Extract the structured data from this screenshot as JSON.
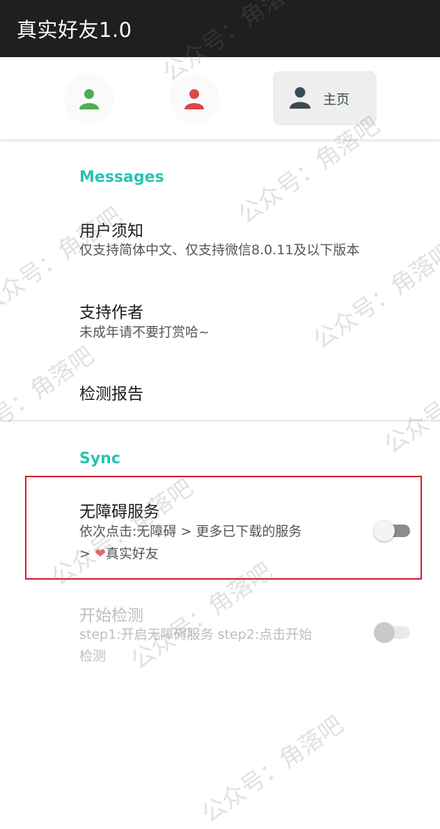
{
  "app": {
    "title": "真实好友1.0"
  },
  "tabs": {
    "tab1_color": "#4caf50",
    "tab2_color": "#e04646",
    "active_label": "主页",
    "active_color": "#3a4a53"
  },
  "messages": {
    "header": "Messages",
    "items": [
      {
        "title": "用户须知",
        "summary": "仅支持简体中文、仅支持微信8.0.11及以下版本"
      },
      {
        "title": "支持作者",
        "summary": "未成年请不要打赏哈~"
      },
      {
        "title": "检测报告"
      }
    ]
  },
  "sync": {
    "header": "Sync",
    "accessibility": {
      "title": "无障碍服务",
      "summary_line1": "依次点击:无障碍 > 更多已下载的服务",
      "summary_line2_prefix": ">",
      "summary_line2_heart": "❤",
      "summary_line2_suffix": "真实好友",
      "enabled": false
    },
    "start_detection": {
      "title": "开始检测",
      "summary_line1": "step1:开启无障碍服务 step2:点击开始",
      "summary_line2": "检测",
      "enabled": false,
      "disabled": true
    }
  },
  "watermark": {
    "text": "公众号：角落吧"
  },
  "colors": {
    "accent": "#2ac2b2",
    "highlight_border": "#cc1b2a",
    "titlebar_bg": "#1e1f21"
  }
}
